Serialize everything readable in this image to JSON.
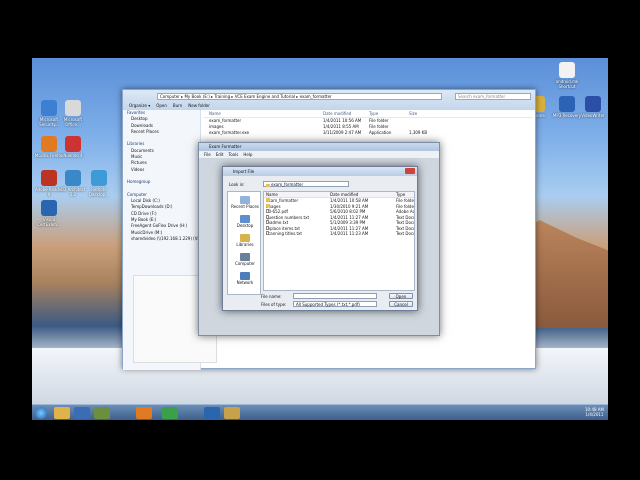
{
  "desktop": {
    "left_icons": [
      {
        "label": "Microsoft Security...",
        "color": "#3c7fd3"
      },
      {
        "label": "Microsoft Office...",
        "color": "#d9d9d9"
      },
      {
        "label": "Mozilla Firefox",
        "color": "#e07b24"
      },
      {
        "label": "Nuendo 4",
        "color": "#c33"
      },
      {
        "label": "Adobe Reader 9",
        "color": "#b32"
      },
      {
        "label": "CD Architect 5.2",
        "color": "#3a88c8"
      },
      {
        "label": "Remote Desktop...",
        "color": "#3f9bd8"
      },
      {
        "label": "Visual CertExam...",
        "color": "#2a66b0"
      }
    ],
    "right_icons": [
      {
        "label": "android.mk Shortcut",
        "color": "#f2f2f2"
      },
      {
        "label": "Chrome",
        "color": "#d9b13b"
      },
      {
        "label": "MP3 Recovery",
        "color": "#2c63b4"
      },
      {
        "label": "VideoWriter",
        "color": "#2b4fa7"
      }
    ]
  },
  "explorer": {
    "breadcrumb": [
      "Computer",
      "My Book (E:)",
      "Training",
      "VCE Exam Engine and Tutorial",
      "exam_formatter"
    ],
    "search_placeholder": "Search exam_formatter",
    "toolbar": [
      "Organize ▾",
      "Open",
      "Burn",
      "New folder"
    ],
    "nav": [
      {
        "label": "Favorites",
        "type": "header"
      },
      {
        "label": "Desktop",
        "type": "item"
      },
      {
        "label": "Downloads",
        "type": "item"
      },
      {
        "label": "Recent Places",
        "type": "item"
      },
      {
        "label": "",
        "type": "spacer"
      },
      {
        "label": "Libraries",
        "type": "header"
      },
      {
        "label": "Documents",
        "type": "item"
      },
      {
        "label": "Music",
        "type": "item"
      },
      {
        "label": "Pictures",
        "type": "item"
      },
      {
        "label": "Videos",
        "type": "item"
      },
      {
        "label": "",
        "type": "spacer"
      },
      {
        "label": "Homegroup",
        "type": "header"
      },
      {
        "label": "",
        "type": "spacer"
      },
      {
        "label": "Computer",
        "type": "header"
      },
      {
        "label": "Local Disk (C:)",
        "type": "item"
      },
      {
        "label": "TempDownloads (D:)",
        "type": "item"
      },
      {
        "label": "CD Drive (F:)",
        "type": "item"
      },
      {
        "label": "My Book (E:)",
        "type": "item"
      },
      {
        "label": "FreeAgent GoFlex Drive (H:)",
        "type": "item"
      },
      {
        "label": "MusicDrive (M:)",
        "type": "item"
      },
      {
        "label": "sharedvideo (\\\\192.168.1.229) (V:)",
        "type": "item"
      }
    ],
    "columns": [
      "Name",
      "Date modified",
      "Type",
      "Size"
    ],
    "files": [
      {
        "name": "exam_formatter",
        "date": "1/4/2011 10:56 AM",
        "type": "File folder",
        "size": ""
      },
      {
        "name": "images",
        "date": "1/4/2011 8:55 AM",
        "type": "File folder",
        "size": ""
      },
      {
        "name": "exam_formatter.exe",
        "date": "3/11/2009 2:47 AM",
        "type": "Application",
        "size": "1,309 KB"
      }
    ]
  },
  "app": {
    "title": "Exam Formatter",
    "menu": [
      "File",
      "Edit",
      "Tools",
      "Help"
    ]
  },
  "dialog": {
    "title": "Import File",
    "look_in_label": "Look in:",
    "look_in_value": "exam_formatter",
    "places": [
      "Recent Places",
      "Desktop",
      "Libraries",
      "Computer",
      "Network"
    ],
    "columns": [
      "Name",
      "Date modified",
      "Type"
    ],
    "files": [
      {
        "name": "exam_formatter",
        "date": "1/4/2011 10:58 AM",
        "type": "File folder",
        "folder": true
      },
      {
        "name": "images",
        "date": "1/30/2010 9:21 AM",
        "type": "File folder",
        "folder": true
      },
      {
        "name": "70-652.pdf",
        "date": "5/6/2010 8:02 PM",
        "type": "Adobe Ac",
        "folder": false
      },
      {
        "name": "question numbers.txt",
        "date": "1/4/2011 11:27 AM",
        "type": "Text Docu",
        "folder": false
      },
      {
        "name": "readme.txt",
        "date": "5/1/2009 3:39 PM",
        "type": "Text Docu",
        "folder": false
      },
      {
        "name": "replace items.txt",
        "date": "1/4/2011 11:27 AM",
        "type": "Text Docu",
        "folder": false
      },
      {
        "name": "scanning titles.txt",
        "date": "1/4/2011 11:23 AM",
        "type": "Text Docu",
        "folder": false
      }
    ],
    "filename_label": "File name:",
    "filetype_label": "Files of type:",
    "filetype_value": "All Supported Types (*.txt,*.pdf)",
    "open_label": "Open",
    "cancel_label": "Cancel"
  },
  "taskbar": {
    "time": "10:48 AM",
    "date": "1/4/2011"
  }
}
